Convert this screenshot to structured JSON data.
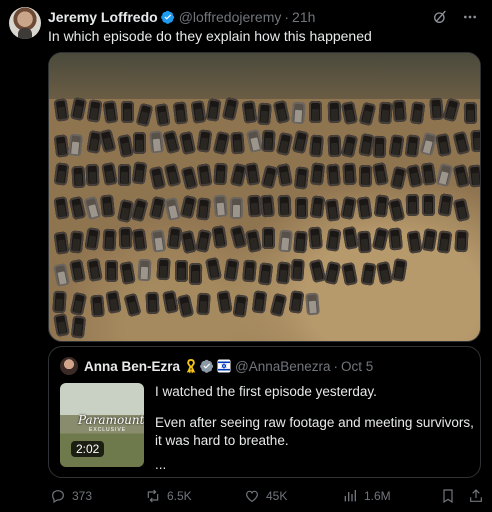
{
  "author": {
    "name": "Jeremy Loffredo",
    "handle": "@loffredojeremy",
    "time": "21h"
  },
  "post": {
    "text": "In which episode do they explain how this happened",
    "media": "aerial-photo-burned-cars"
  },
  "quote": {
    "name": "Anna Ben-Ezra",
    "handle": "@AnnaBenezra",
    "date": "Oct 5",
    "paragraph1": "I watched the first episode yesterday.",
    "paragraph2": "Even after seeing raw footage and meeting survivors, it was hard to breathe.",
    "ellipsis": "...",
    "thumbnail": {
      "brand": "Paramount+",
      "tag": "EXCLUSIVE",
      "duration": "2:02"
    }
  },
  "actions": {
    "replies": "373",
    "reposts": "6.5K",
    "likes": "45K",
    "views": "1.6M"
  },
  "colors": {
    "background": "#000000",
    "text": "#e7e9ea",
    "muted": "#71767b",
    "verified": "#1d9bf0",
    "border": "#2f3336",
    "ribbon": "#f5c518"
  },
  "icons": [
    "grok-icon",
    "more-icon",
    "verified-icon",
    "yellow-ribbon-icon",
    "org-badge-icon",
    "flag-icon",
    "reply-icon",
    "repost-icon",
    "like-icon",
    "views-icon",
    "bookmark-icon",
    "share-icon"
  ]
}
